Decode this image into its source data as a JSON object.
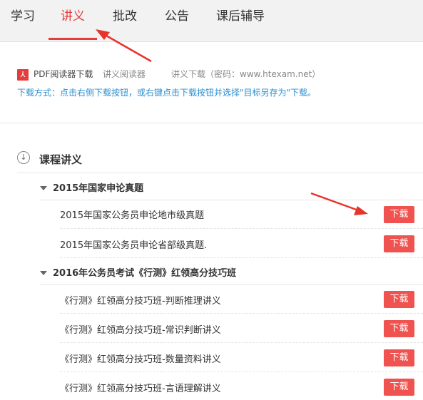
{
  "tabs": [
    {
      "label": "学习",
      "active": false
    },
    {
      "label": "讲义",
      "active": true
    },
    {
      "label": "批改",
      "active": false
    },
    {
      "label": "公告",
      "active": false
    },
    {
      "label": "课后辅导",
      "active": false
    }
  ],
  "download_info": {
    "pdf_icon": "pdf-icon",
    "pdf_reader_link": "PDF阅读器下载",
    "handout_reader": "讲义阅读器",
    "handout_download": "讲义下载（密码：www.htexam.net）",
    "method": "下载方式：点击右侧下载按钮，或右键点击下载按钮并选择\"目标另存为\"下载。"
  },
  "section": {
    "icon": "download-circle-icon",
    "title": "课程讲义"
  },
  "groups": [
    {
      "title": "2015年国家申论真题",
      "items": [
        {
          "label": "2015年国家公务员申论地市级真题",
          "button": "下载"
        },
        {
          "label": "2015年国家公务员申论省部级真题.",
          "button": "下载"
        }
      ]
    },
    {
      "title": "2016年公务员考试《行测》红领高分技巧班",
      "items": [
        {
          "label": "《行测》红领高分技巧班-判断推理讲义",
          "button": "下载"
        },
        {
          "label": "《行测》红领高分技巧班-常识判断讲义",
          "button": "下载"
        },
        {
          "label": "《行测》红领高分技巧班-数量资料讲义",
          "button": "下载"
        },
        {
          "label": "《行测》红领高分技巧班-言语理解讲义",
          "button": "下载"
        }
      ]
    }
  ],
  "colors": {
    "accent": "#e43d3d",
    "button": "#f0524f",
    "link": "#2a8fd0"
  }
}
